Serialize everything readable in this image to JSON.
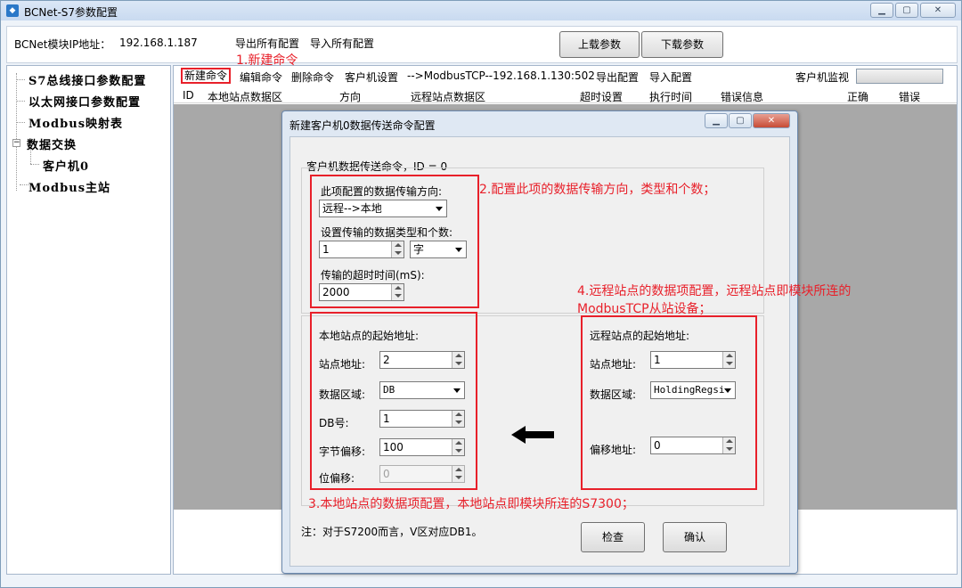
{
  "window": {
    "title": "BCNet-S7参数配置",
    "app_icon": "app-icon"
  },
  "topbar": {
    "ip_label": "BCNet模块IP地址：",
    "ip_value": "192.168.1.187",
    "export_all": "导出所有配置",
    "import_all": "导入所有配置",
    "upload": "上载参数",
    "download": "下载参数"
  },
  "tree": {
    "items": [
      "S7总线接口参数配置",
      "以太网接口参数配置",
      "Modbus映射表",
      "数据交换",
      "客户机0",
      "Modbus主站"
    ]
  },
  "toolbar": {
    "new_cmd": "新建命令",
    "edit_cmd": "编辑命令",
    "delete_cmd": "删除命令",
    "client_settings": "客户机设置",
    "route": "-->ModbusTCP--192.168.1.130:502",
    "export_cfg": "导出配置",
    "import_cfg": "导入配置",
    "client_monitor": "客户机监视"
  },
  "table": {
    "headers": [
      "ID",
      "本地站点数据区",
      "方向",
      "远程站点数据区",
      "超时设置",
      "执行时间",
      "错误信息",
      "正确",
      "错误"
    ]
  },
  "annotations": {
    "a1": "1.新建命令",
    "a2": "2.配置此项的数据传输方向，类型和个数；",
    "a3": "3.本地站点的数据项配置，本地站点即模块所连的S7300；",
    "a4_line1": "4.远程站点的数据项配置，远程站点即模块所连的",
    "a4_line2": "ModbusTCP从站设备；"
  },
  "dialog": {
    "title": "新建客户机0数据传送命令配置",
    "cmd_header": "客户机数据传送命令，ID = 0",
    "direction_label": "此项配置的数据传输方向:",
    "direction_value": "远程-->本地",
    "type_count_label": "设置传输的数据类型和个数:",
    "count_value": "1",
    "type_value": "字",
    "timeout_label": "传输的超时时间(mS):",
    "timeout_value": "2000",
    "local": {
      "header": "本地站点的起始地址:",
      "station_label": "站点地址:",
      "station_value": "2",
      "area_label": "数据区域:",
      "area_value": "DB",
      "db_label": "DB号:",
      "db_value": "1",
      "byte_label": "字节偏移:",
      "byte_value": "100",
      "bit_label": "位偏移:",
      "bit_value": "0"
    },
    "remote": {
      "header": "远程站点的起始地址:",
      "station_label": "站点地址:",
      "station_value": "1",
      "area_label": "数据区域:",
      "area_value": "HoldingRegsi",
      "offset_label": "偏移地址:",
      "offset_value": "0"
    },
    "note": "注：对于S7200而言，V区对应DB1。",
    "check": "检查",
    "confirm": "确认"
  },
  "colors": {
    "annotation_red": "#e8202a",
    "grid_gray": "#a8a8a8"
  }
}
